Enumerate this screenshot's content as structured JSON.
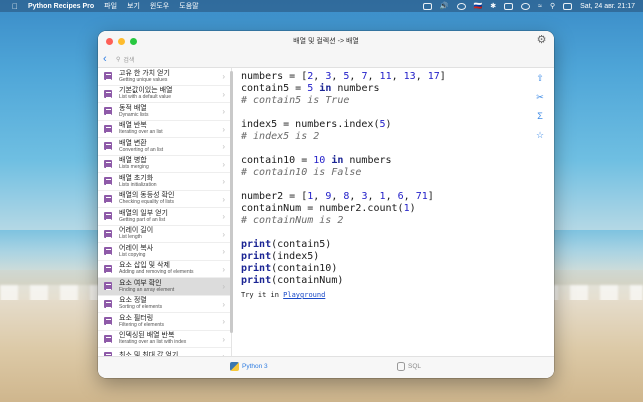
{
  "menubar": {
    "app_name": "Python Recipes Pro",
    "menus": [
      "파일",
      "보기",
      "윈도우",
      "도움말"
    ],
    "clock": "Sat, 24 авг.  21:17",
    "input_source": "🇷🇺"
  },
  "window": {
    "title": "배열 및 컬렉션 -> 배열",
    "search_placeholder": "검색"
  },
  "sidebar": {
    "items": [
      {
        "kr": "고유 한 가치 얻기",
        "en": "Getting unique values"
      },
      {
        "kr": "기본값이있는 배열",
        "en": "List with a default value"
      },
      {
        "kr": "동적 배열",
        "en": "Dynamic lists"
      },
      {
        "kr": "배열 반복",
        "en": "Iterating over an list"
      },
      {
        "kr": "배열 변환",
        "en": "Converting of an list"
      },
      {
        "kr": "배열 병합",
        "en": "Lists merging"
      },
      {
        "kr": "배열 초기화",
        "en": "Lists initialization"
      },
      {
        "kr": "배열의 동등성 확인",
        "en": "Checking equality of lists"
      },
      {
        "kr": "배열의 일부 얻기",
        "en": "Getting part of an list"
      },
      {
        "kr": "어레이 길이",
        "en": "List length"
      },
      {
        "kr": "어레이 복사",
        "en": "List copying"
      },
      {
        "kr": "요소 삽입 및 삭제",
        "en": "Adding and removing of elements"
      },
      {
        "kr": "요소 여부 확인",
        "en": "Finding an array element"
      },
      {
        "kr": "요소 정렬",
        "en": "Sorting of elements"
      },
      {
        "kr": "요소 필터링",
        "en": "Filtering of elements"
      },
      {
        "kr": "인덱싱된 배열 반복",
        "en": "Iterating over an list with index"
      },
      {
        "kr": "최소 및 최대 값 얻기",
        "en": ""
      }
    ],
    "selected_index": 12
  },
  "code": {
    "l1": {
      "a": "numbers = [",
      "n1": "2",
      "c1": ", ",
      "n2": "3",
      "c2": ", ",
      "n3": "5",
      "c3": ", ",
      "n4": "7",
      "c4": ", ",
      "n5": "11",
      "c5": ", ",
      "n6": "13",
      "c6": ", ",
      "n7": "17",
      "z": "]"
    },
    "l2": {
      "a": "contain5 = ",
      "n": "5",
      "b": " ",
      "kw": "in",
      "c": " numbers"
    },
    "l3": "# contain5 is True",
    "l4": {
      "a": "index5 = numbers.index(",
      "n": "5",
      "b": ")"
    },
    "l5": "# index5 is 2",
    "l6": {
      "a": "contain10 = ",
      "n": "10",
      "b": " ",
      "kw": "in",
      "c": " numbers"
    },
    "l7": "# contain10 is False",
    "l8": {
      "a": "number2 = [",
      "n1": "1",
      "c1": ", ",
      "n2": "9",
      "c2": ", ",
      "n3": "8",
      "c3": ", ",
      "n4": "3",
      "c4": ", ",
      "n5": "1",
      "c5": ", ",
      "n6": "6",
      "c6": ", ",
      "n7": "71",
      "z": "]"
    },
    "l9": {
      "a": "containNum = number2.count(",
      "n": "1",
      "b": ")"
    },
    "l10": "# containNum is 2",
    "prints": [
      {
        "kw": "print",
        "arg": "(contain5)"
      },
      {
        "kw": "print",
        "arg": "(index5)"
      },
      {
        "kw": "print",
        "arg": "(contain10)"
      },
      {
        "kw": "print",
        "arg": "(containNum)"
      }
    ],
    "try_prefix": "Try it in ",
    "try_link": "Playground"
  },
  "bottombar": {
    "python_label": "Python 3",
    "sql_label": "SQL"
  },
  "colors": {
    "accent": "#2f7de1",
    "keyword": "#1b2594",
    "number": "#2320c9",
    "comment": "#6b6b6b",
    "list_icon": "#8e5aa8"
  }
}
